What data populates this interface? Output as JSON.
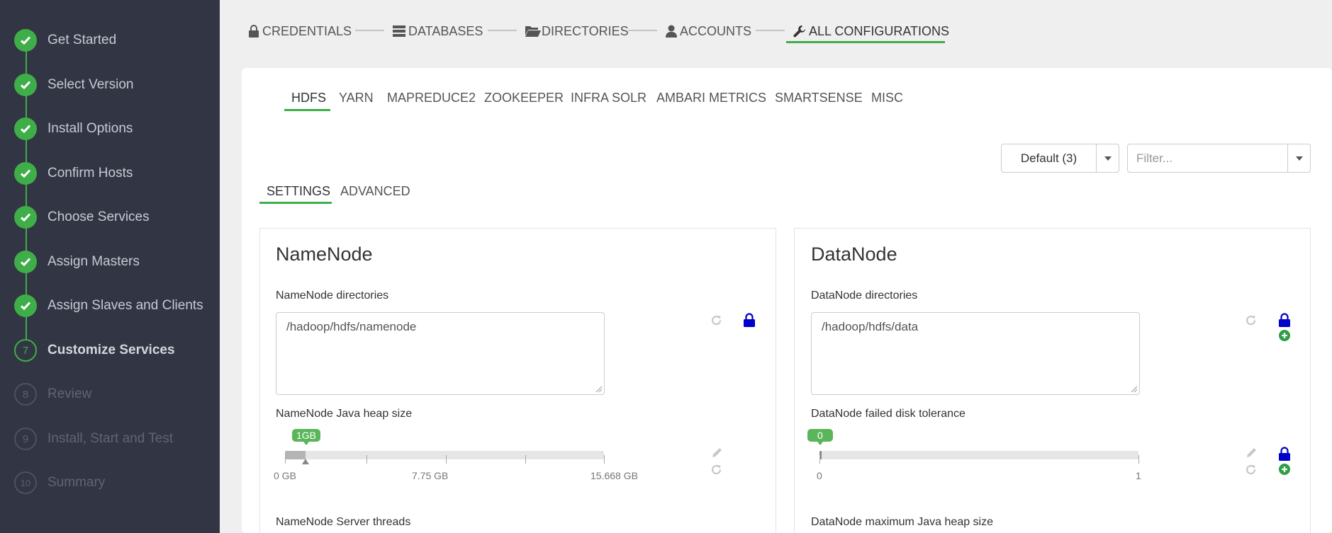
{
  "sidebar": {
    "steps": [
      {
        "label": "Get Started",
        "state": "done"
      },
      {
        "label": "Select Version",
        "state": "done"
      },
      {
        "label": "Install Options",
        "state": "done"
      },
      {
        "label": "Confirm Hosts",
        "state": "done"
      },
      {
        "label": "Choose Services",
        "state": "done"
      },
      {
        "label": "Assign Masters",
        "state": "done"
      },
      {
        "label": "Assign Slaves and Clients",
        "state": "done"
      },
      {
        "label": "Customize Services",
        "state": "active",
        "number": "7"
      },
      {
        "label": "Review",
        "state": "future",
        "number": "8"
      },
      {
        "label": "Install, Start and Test",
        "state": "future",
        "number": "9"
      },
      {
        "label": "Summary",
        "state": "future",
        "number": "10"
      }
    ]
  },
  "wizard_tabs": [
    {
      "label": "CREDENTIALS",
      "icon": "lock-icon"
    },
    {
      "label": "DATABASES",
      "icon": "database-icon"
    },
    {
      "label": "DIRECTORIES",
      "icon": "folder-open-icon"
    },
    {
      "label": "ACCOUNTS",
      "icon": "user-icon"
    },
    {
      "label": "ALL CONFIGURATIONS",
      "icon": "wrench-icon",
      "active": true
    }
  ],
  "service_tabs": [
    "HDFS",
    "YARN",
    "MAPREDUCE2",
    "ZOOKEEPER",
    "INFRA SOLR",
    "AMBARI METRICS",
    "SMARTSENSE",
    "MISC"
  ],
  "config_group": {
    "label": "Default (3)"
  },
  "filter": {
    "placeholder": "Filter..."
  },
  "sub_tabs": [
    "SETTINGS",
    "ADVANCED"
  ],
  "namenode": {
    "title": "NameNode",
    "dirs_label": "NameNode directories",
    "dirs_value": "/hadoop/hdfs/namenode",
    "heap_label": "NameNode Java heap size",
    "heap_value": "1GB",
    "heap_ticks": [
      "0 GB",
      "7.75 GB",
      "15.668 GB"
    ],
    "heap_fraction": 0.0638,
    "threads_label": "NameNode Server threads"
  },
  "datanode": {
    "title": "DataNode",
    "dirs_label": "DataNode directories",
    "dirs_value": "/hadoop/hdfs/data",
    "tolerance_label": "DataNode failed disk tolerance",
    "tolerance_value": "0",
    "tolerance_ticks": [
      "0",
      "1"
    ],
    "tolerance_fraction": 0,
    "heap_label": "DataNode maximum Java heap size"
  },
  "colors": {
    "accent": "#3fae49",
    "lock": "#0000cc",
    "sidebar": "#323544"
  }
}
